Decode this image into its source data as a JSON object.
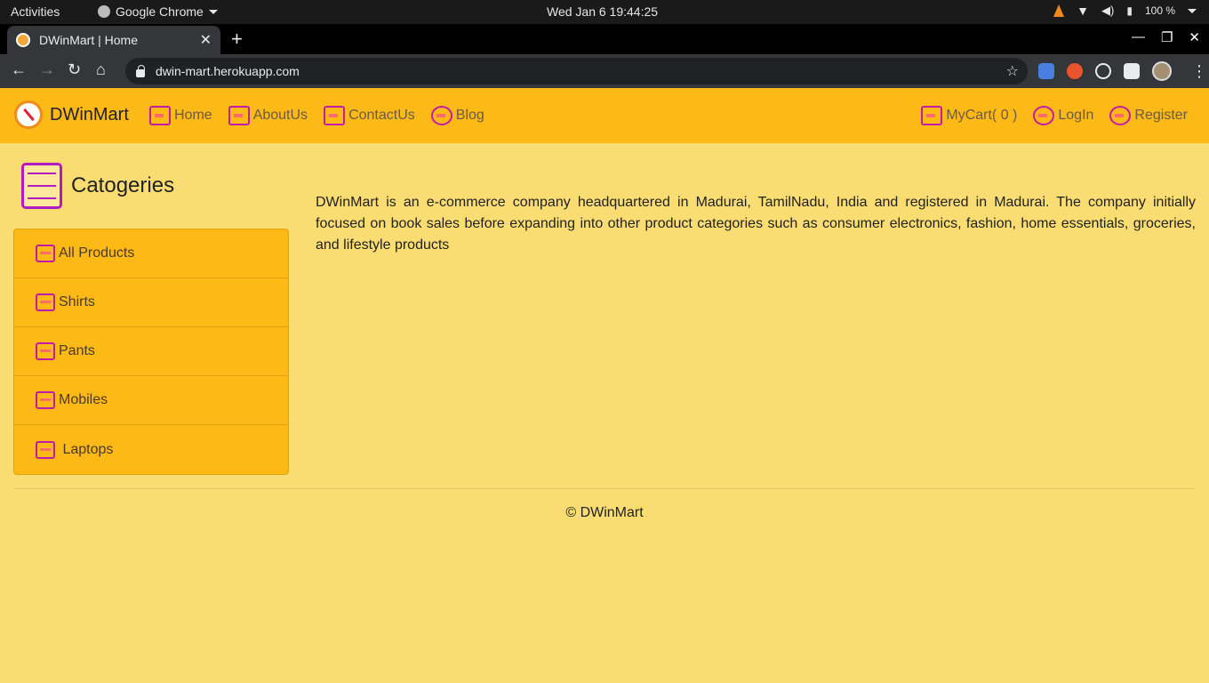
{
  "system": {
    "activities": "Activities",
    "app_name": "Google Chrome",
    "clock": "Wed Jan 6  19:44:25",
    "battery": "100 %"
  },
  "browser": {
    "tab_title": "DWinMart | Home",
    "url": "dwin-mart.herokuapp.com"
  },
  "site": {
    "brand": "DWinMart",
    "nav": [
      {
        "label": "Home",
        "icon": "store-icon"
      },
      {
        "label": "AboutUs",
        "icon": "info-book-icon"
      },
      {
        "label": "ContactUs",
        "icon": "contact-card-icon"
      },
      {
        "label": "Blog",
        "icon": "blog-icon"
      }
    ],
    "nav_right": [
      {
        "label": "MyCart( 0 )",
        "icon": "cart-icon"
      },
      {
        "label": "LogIn",
        "icon": "login-icon"
      },
      {
        "label": "Register",
        "icon": "register-user-icon"
      }
    ],
    "categories_title": "Catogeries",
    "categories": [
      {
        "label": "All Products",
        "icon": "list-icon"
      },
      {
        "label": "Shirts",
        "icon": "box-icon"
      },
      {
        "label": "Pants",
        "icon": "box-icon"
      },
      {
        "label": "Mobiles",
        "icon": "box-icon"
      },
      {
        "label": " Laptops",
        "icon": "box-icon"
      }
    ],
    "about_text": "DWinMart is an e-commerce company headquartered in Madurai, TamilNadu, India and registered in Madurai. The company initially focused on book sales before expanding into other product categories such as consumer electronics, fashion, home essentials, groceries, and lifestyle products",
    "footer": "© DWinMart"
  },
  "colors": {
    "page_bg": "#f9dd73",
    "navbar_bg": "#fdb916",
    "icon_accent": "#c41aa8"
  }
}
